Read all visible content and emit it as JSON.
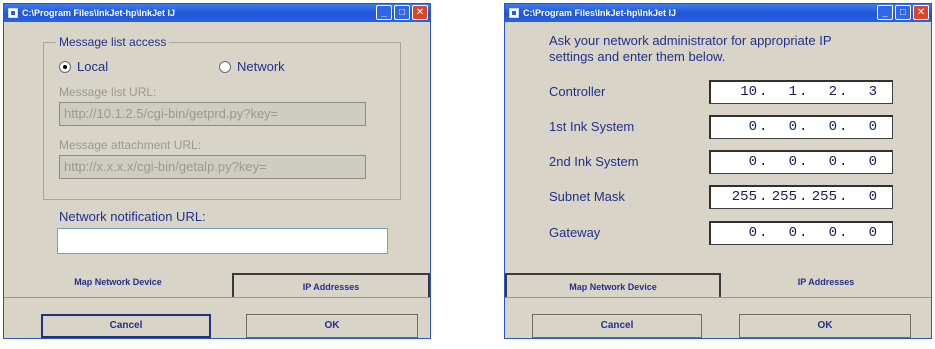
{
  "left_window": {
    "title": "C:\\Program Files\\InkJet-hp\\InkJet IJ",
    "group": {
      "legend": "Message list access",
      "radio_local": "Local",
      "radio_network": "Network",
      "selected": "Local",
      "list_url_label": "Message list URL:",
      "list_url_value": "http://10.1.2.5/cgi-bin/getprd.py?key=",
      "attach_url_label": "Message attachment URL:",
      "attach_url_value": "http://x.x.x.x/cgi-bin/getalp.py?key="
    },
    "notification_label": "Network notification URL:",
    "notification_value": "",
    "tabs": [
      "Map Network Device",
      "IP Addresses"
    ],
    "active_tab": "Map Network Device",
    "buttons": {
      "cancel": "Cancel",
      "ok": "OK"
    }
  },
  "right_window": {
    "title": "C:\\Program Files\\InkJet-hp\\InkJet IJ",
    "instructions_line1": "Ask your network administrator for appropriate IP",
    "instructions_line2": "settings and enter them below.",
    "rows": [
      {
        "label": "Controller",
        "octets": [
          "10",
          "1",
          "2",
          "3"
        ]
      },
      {
        "label": "1st Ink System",
        "octets": [
          "0",
          "0",
          "0",
          "0"
        ]
      },
      {
        "label": "2nd Ink System",
        "octets": [
          "0",
          "0",
          "0",
          "0"
        ]
      },
      {
        "label": "Subnet Mask",
        "octets": [
          "255",
          "255",
          "255",
          "0"
        ]
      },
      {
        "label": "Gateway",
        "octets": [
          "0",
          "0",
          "0",
          "0"
        ]
      }
    ],
    "tabs": [
      "Map Network Device",
      "IP Addresses"
    ],
    "active_tab": "IP Addresses",
    "buttons": {
      "cancel": "Cancel",
      "ok": "OK"
    }
  },
  "colors": {
    "titlebar": "#1f55d6",
    "dialog_bg": "#d8d4c8",
    "label_text": "#24308c",
    "disabled_text": "#9a9890",
    "close_button": "#d9472b"
  }
}
